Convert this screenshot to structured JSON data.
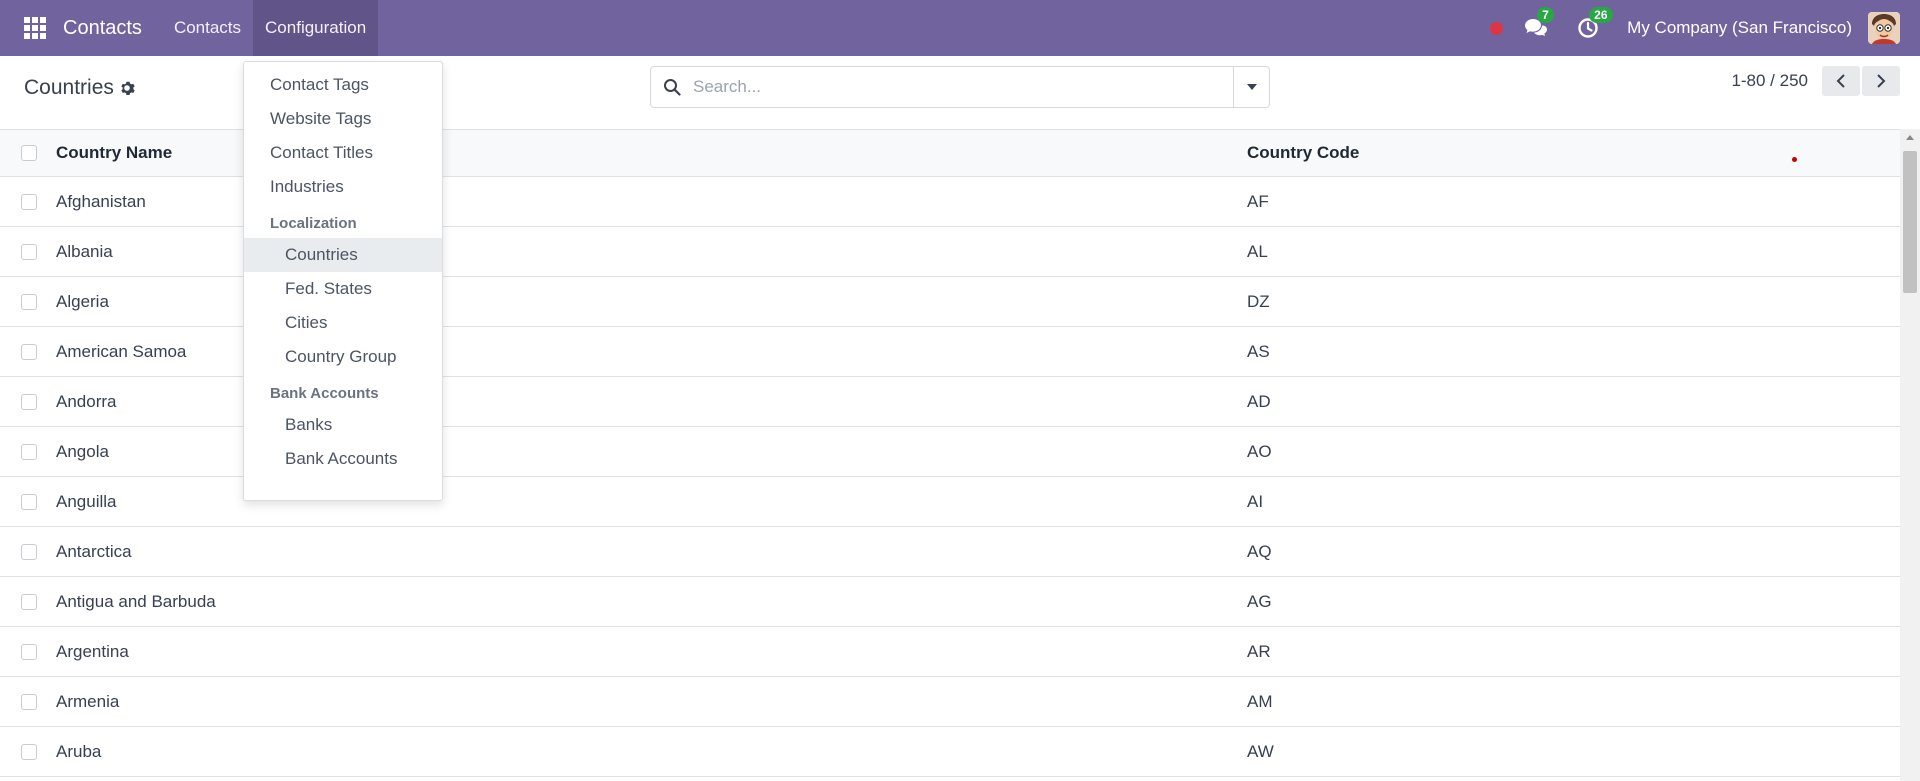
{
  "navbar": {
    "brand": "Contacts",
    "menu": [
      {
        "label": "Contacts",
        "active": false
      },
      {
        "label": "Configuration",
        "active": true
      }
    ],
    "messages_count": "7",
    "activities_count": "26",
    "company": "My Company (San Francisco)",
    "bg_color": "#71639e"
  },
  "control": {
    "title": "Countries",
    "search_placeholder": "Search...",
    "pager": "1-80 / 250"
  },
  "dropdown": {
    "items": [
      "Contact Tags",
      "Website Tags",
      "Contact Titles",
      "Industries"
    ],
    "localization_header": "Localization",
    "localization_items": [
      "Countries",
      "Fed. States",
      "Cities",
      "Country Group"
    ],
    "bank_header": "Bank Accounts",
    "bank_items": [
      "Banks",
      "Bank Accounts"
    ],
    "selected": "Countries"
  },
  "list": {
    "columns": {
      "name": "Country Name",
      "code": "Country Code"
    },
    "rows": [
      {
        "name": "Afghanistan",
        "code": "AF"
      },
      {
        "name": "Albania",
        "code": "AL"
      },
      {
        "name": "Algeria",
        "code": "DZ"
      },
      {
        "name": "American Samoa",
        "code": "AS"
      },
      {
        "name": "Andorra",
        "code": "AD"
      },
      {
        "name": "Angola",
        "code": "AO"
      },
      {
        "name": "Anguilla",
        "code": "AI"
      },
      {
        "name": "Antarctica",
        "code": "AQ"
      },
      {
        "name": "Antigua and Barbuda",
        "code": "AG"
      },
      {
        "name": "Argentina",
        "code": "AR"
      },
      {
        "name": "Armenia",
        "code": "AM"
      },
      {
        "name": "Aruba",
        "code": "AW"
      }
    ]
  }
}
